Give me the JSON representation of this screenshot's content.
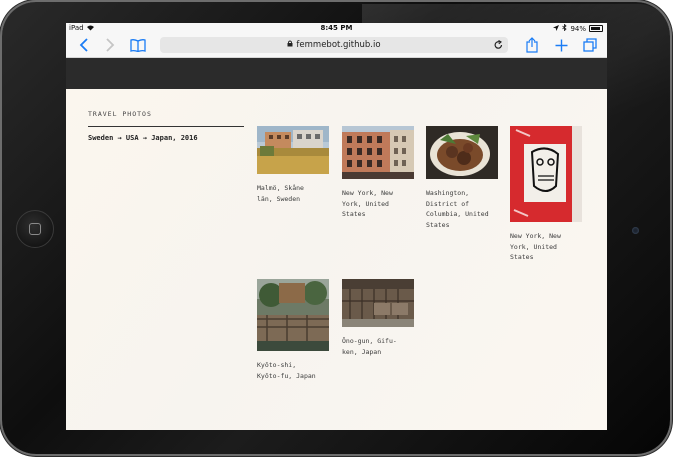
{
  "statusbar": {
    "device": "iPad",
    "time": "8:45 PM",
    "battery": "94%"
  },
  "browser": {
    "url": "femmebot.github.io",
    "icons": [
      "back-icon",
      "forward-icon",
      "bookmarks-icon",
      "lock-icon",
      "reload-icon",
      "share-icon",
      "new-tab-icon",
      "tabs-icon"
    ]
  },
  "sidebar": {
    "title": "TRAVEL PHOTOS",
    "route": "Sweden → USA → Japan, 2016"
  },
  "photos": [
    {
      "caption": "Malmö, Skåne län, Sweden"
    },
    {
      "caption": "New York, New York, United States"
    },
    {
      "caption": "Washington, District of Columbia, United States"
    },
    {
      "caption": "New York, New York, United States"
    },
    {
      "caption": "Kyōto-shi, Kyōto-fu, Japan"
    },
    {
      "caption": "Ōno-gun, Gifu-ken, Japan"
    }
  ],
  "colors": {
    "accent": "#1a7cf5",
    "page_background": "#fbf7f0",
    "header_band": "#2b2b2b",
    "device_frame": "#111111"
  }
}
